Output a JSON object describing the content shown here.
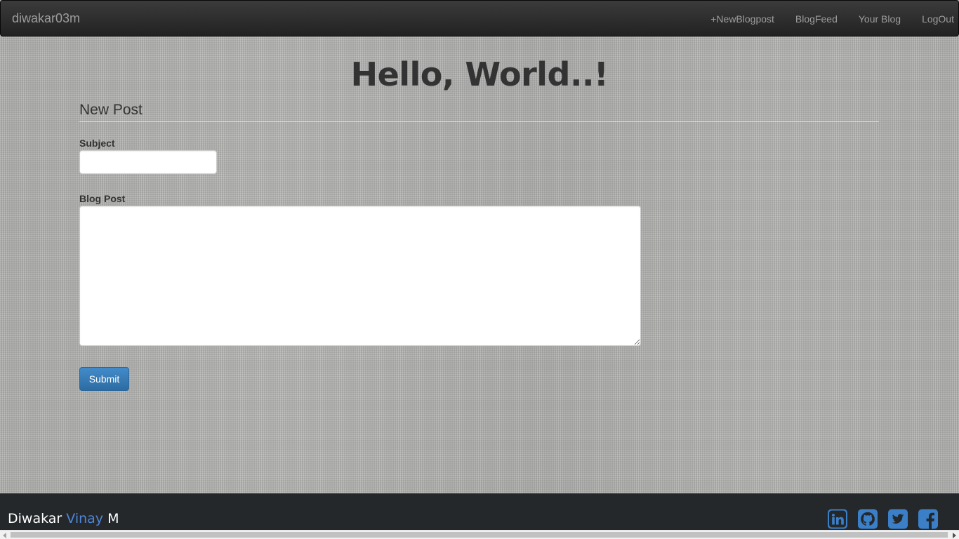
{
  "navbar": {
    "brand": "diwakar03m",
    "links": [
      {
        "label": "+NewBlogpost"
      },
      {
        "label": "BlogFeed"
      },
      {
        "label": "Your Blog"
      },
      {
        "label": "LogOut"
      }
    ]
  },
  "hero": {
    "title": "Hello, World..!"
  },
  "form": {
    "legend": "New Post",
    "subject_label": "Subject",
    "subject_value": "",
    "post_label": "Blog Post",
    "post_value": "",
    "submit_label": "Submit"
  },
  "footer": {
    "name_first": "Diwakar",
    "name_middle": "Vinay",
    "name_last": "M",
    "social": [
      "linkedin-icon",
      "github-icon",
      "twitter-icon",
      "facebook-icon"
    ]
  },
  "colors": {
    "accent": "#4f86d6",
    "primary_button": "#428bca",
    "navbar": "#222222",
    "footer": "#24282b"
  }
}
